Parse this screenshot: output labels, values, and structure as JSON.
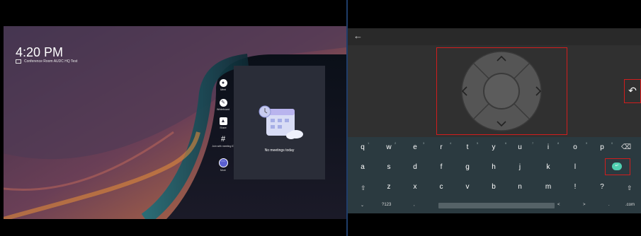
{
  "left": {
    "clock": "4:20 PM",
    "room": "Conference Room AUDC HQ Test",
    "dock": [
      {
        "name": "meet",
        "label": "Meet"
      },
      {
        "name": "whiteboard",
        "label": "Whiteboard"
      },
      {
        "name": "share",
        "label": "Share"
      },
      {
        "name": "join",
        "label": "Join with meeting ID"
      },
      {
        "name": "more",
        "label": "More"
      }
    ],
    "meetings_text": "No meetings today"
  },
  "right": {
    "keyboard": {
      "row1": [
        "q",
        "w",
        "e",
        "r",
        "t",
        "y",
        "u",
        "i",
        "o",
        "p"
      ],
      "row1_hints": [
        "1",
        "2",
        "3",
        "4",
        "5",
        "6",
        "7",
        "8",
        "9",
        "0"
      ],
      "row2": [
        "a",
        "s",
        "d",
        "f",
        "g",
        "h",
        "j",
        "k",
        "l"
      ],
      "row3": [
        "z",
        "x",
        "c",
        "v",
        "b",
        "n",
        "m",
        "!",
        "?"
      ],
      "bottom": {
        "mode": "?123",
        "comma": ",",
        "left": "<",
        "right": ">",
        "period": ".",
        "com": ".com"
      }
    }
  },
  "colors": {
    "highlight": "#d21d1d",
    "enter": "#4fd0b0",
    "keyboard_bg": "#2b3a40"
  }
}
